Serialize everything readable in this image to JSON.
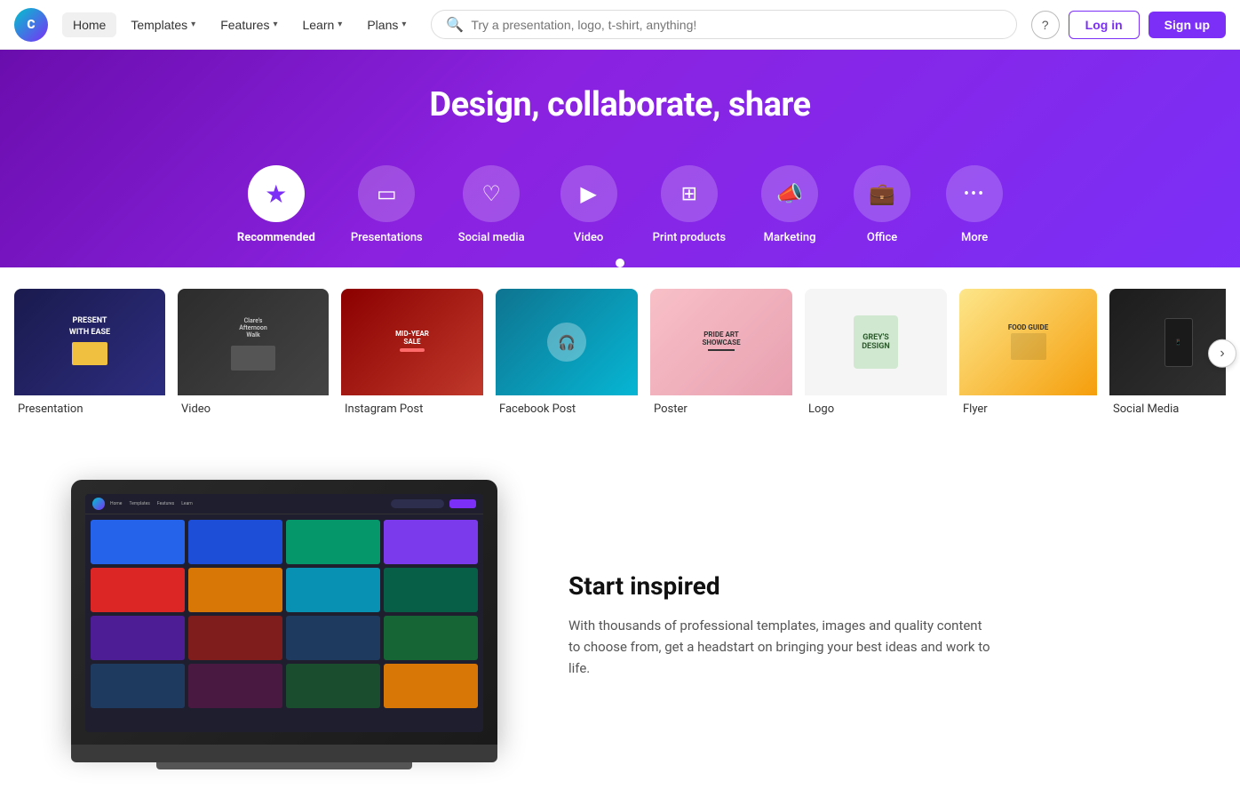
{
  "brand": {
    "name": "Canva",
    "logo_text": "C"
  },
  "navbar": {
    "home_label": "Home",
    "templates_label": "Templates",
    "features_label": "Features",
    "learn_label": "Learn",
    "plans_label": "Plans",
    "search_placeholder": "Try a presentation, logo, t-shirt, anything!",
    "help_icon": "?",
    "login_label": "Log in",
    "signup_label": "Sign up"
  },
  "hero": {
    "title": "Design, collaborate, share"
  },
  "categories": [
    {
      "id": "recommended",
      "label": "Recommended",
      "icon": "★",
      "active": true
    },
    {
      "id": "presentations",
      "label": "Presentations",
      "icon": "▭"
    },
    {
      "id": "social-media",
      "label": "Social media",
      "icon": "♡"
    },
    {
      "id": "video",
      "label": "Video",
      "icon": "▶"
    },
    {
      "id": "print-products",
      "label": "Print products",
      "icon": "⊞"
    },
    {
      "id": "marketing",
      "label": "Marketing",
      "icon": "📣"
    },
    {
      "id": "office",
      "label": "Office",
      "icon": "💼"
    },
    {
      "id": "more",
      "label": "More",
      "icon": "···"
    }
  ],
  "design_cards": [
    {
      "label": "Presentation",
      "bg": "dark-blue"
    },
    {
      "label": "Video",
      "bg": "laptop-gray"
    },
    {
      "label": "Instagram Post",
      "bg": "red-dark"
    },
    {
      "label": "Facebook Post",
      "bg": "teal"
    },
    {
      "label": "Poster",
      "bg": "pink-art"
    },
    {
      "label": "Logo",
      "bg": "green-light"
    },
    {
      "label": "Flyer",
      "bg": "yellow"
    },
    {
      "label": "Social Media",
      "bg": "dark-phone"
    }
  ],
  "inspired_section": {
    "title": "Start inspired",
    "description": "With thousands of professional templates, images and quality content to choose from, get a headstart on bringing your best ideas and work to life."
  },
  "laptop_cells": [
    {
      "color": "lc1"
    },
    {
      "color": "lc2"
    },
    {
      "color": "lc3"
    },
    {
      "color": "lc4"
    },
    {
      "color": "lc5"
    },
    {
      "color": "lc6"
    },
    {
      "color": "lc7"
    },
    {
      "color": "lc8"
    },
    {
      "color": "lc9"
    },
    {
      "color": "lc10"
    },
    {
      "color": "lc11"
    },
    {
      "color": "lc12"
    }
  ]
}
